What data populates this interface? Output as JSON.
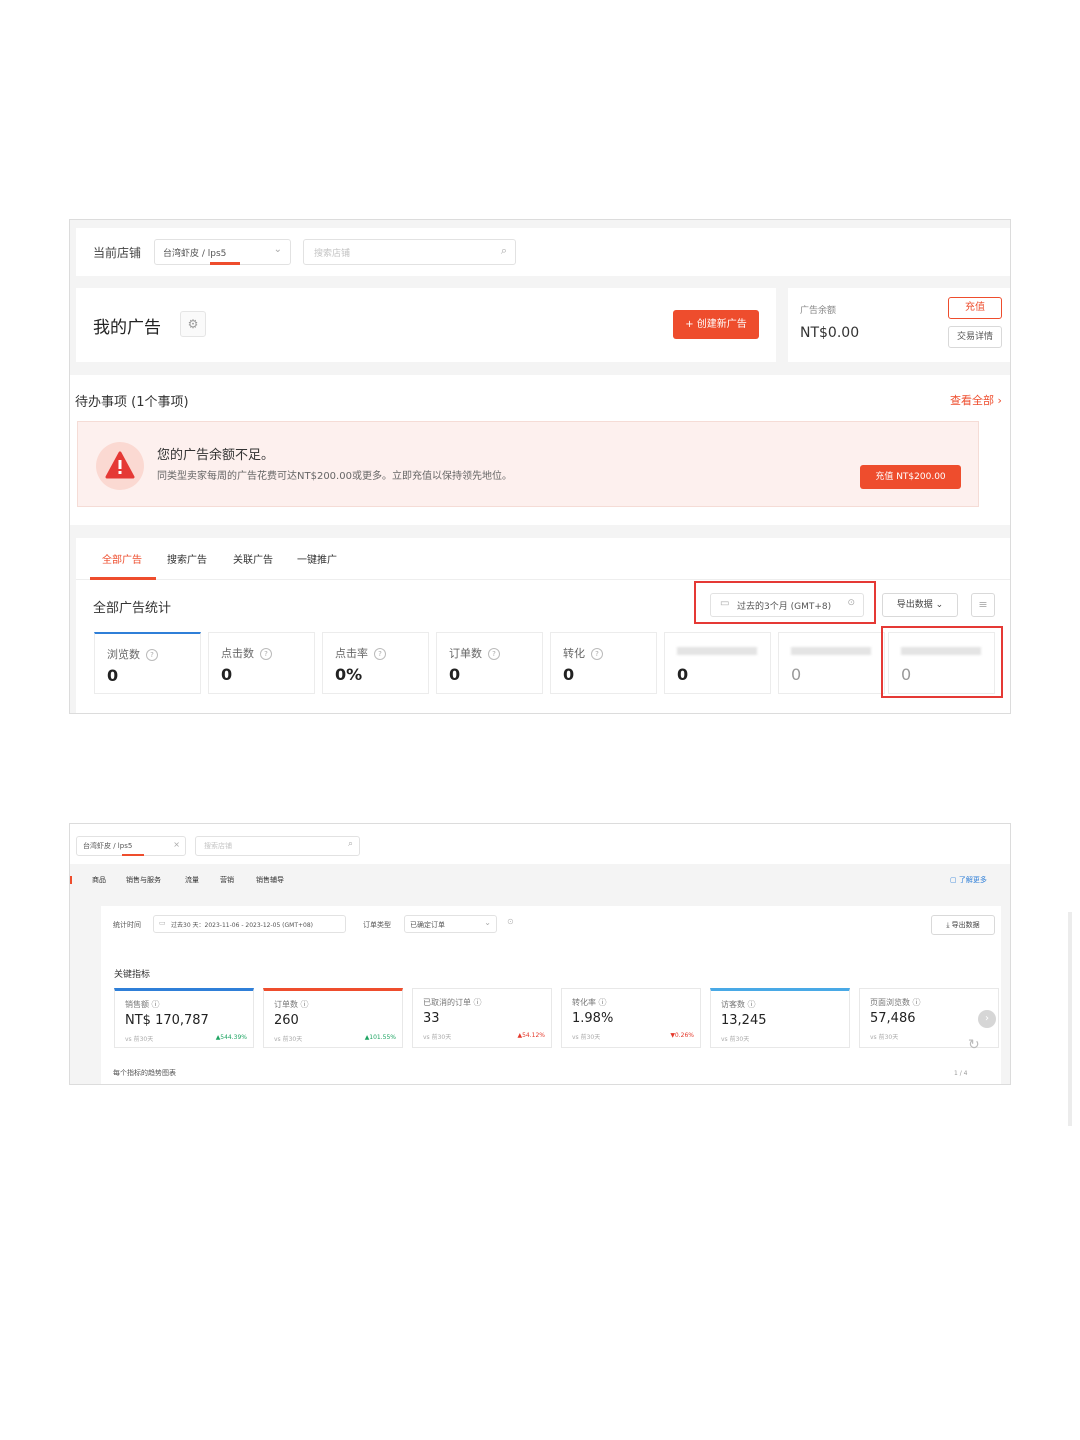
{
  "screen1": {
    "store_bar": {
      "label": "当前店铺",
      "store_value": "台湾虾皮 / lps5",
      "search_placeholder": "搜索店铺"
    },
    "header": {
      "title": "我的广告",
      "create_button": "+ 创建新广告",
      "balance_label": "广告余额",
      "balance_value": "NT$0.00",
      "recharge_button": "充值",
      "transaction_button": "交易详情"
    },
    "todo": {
      "title": "待办事项 (1个事项)",
      "view_all": "查看全部",
      "alert_title": "您的广告余额不足。",
      "alert_desc": "同类型卖家每周的广告花费可达NT$200.00或更多。立即充值以保持领先地位。",
      "alert_button": "充值 NT$200.00"
    },
    "tabs": [
      "全部广告",
      "搜索广告",
      "关联广告",
      "一键推广"
    ],
    "stats": {
      "title": "全部广告统计",
      "date_range": "过去的3个月 (GMT+8)",
      "export_button": "导出数据",
      "metrics": [
        {
          "label": "浏览数",
          "value": "0"
        },
        {
          "label": "点击数",
          "value": "0"
        },
        {
          "label": "点击率",
          "value": "0%"
        },
        {
          "label": "订单数",
          "value": "0"
        },
        {
          "label": "转化",
          "value": "0"
        },
        {
          "label": "",
          "value": "0"
        },
        {
          "label": "",
          "value": "0"
        },
        {
          "label": "",
          "value": "0"
        }
      ]
    }
  },
  "screen2": {
    "store_value": "台湾虾皮 / lps5",
    "search_placeholder": "搜索店铺",
    "nav": [
      "商品",
      "销售与服务",
      "流量",
      "营销",
      "销售辅导"
    ],
    "learn_more": "了解更多",
    "filter": {
      "period_label": "统计时间",
      "period_value": "过去30 天：2023-11-06 - 2023-12-05 (GMT+08)",
      "order_type_label": "订单类型",
      "order_type_value": "已确定订单",
      "export_button": "导出数据"
    },
    "key_metrics_title": "关键指标",
    "metrics": [
      {
        "label": "销售额",
        "value": "NT$ 170,787",
        "compare": "vs 前30天",
        "change": "▲544.39%",
        "dir": "up",
        "accent": "#2f7fd8"
      },
      {
        "label": "订单数",
        "value": "260",
        "compare": "vs 前30天",
        "change": "▲101.55%",
        "dir": "up",
        "accent": "#ee4d2d"
      },
      {
        "label": "已取消的订单",
        "value": "33",
        "compare": "vs 前30天",
        "change": "▲54.12%",
        "dir": "down",
        "accent": ""
      },
      {
        "label": "转化率",
        "value": "1.98%",
        "compare": "vs 前30天",
        "change": "▼0.26%",
        "dir": "down",
        "accent": ""
      },
      {
        "label": "访客数",
        "value": "13,245",
        "compare": "vs 前30天",
        "change": "",
        "dir": "up",
        "accent": "#49a9e6"
      },
      {
        "label": "页面浏览数",
        "value": "57,486",
        "compare": "vs 前30天",
        "change": "",
        "dir": "up",
        "accent": ""
      }
    ],
    "trend_title": "每个指标的趋势图表",
    "pager": "1 / 4"
  },
  "colors": {
    "brand": "#ee4d2d",
    "alert_bg": "#fdf0ee",
    "highlight_box": "#e53935"
  }
}
